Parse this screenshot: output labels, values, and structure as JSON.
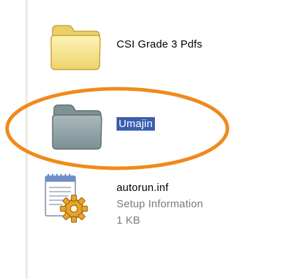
{
  "files": [
    {
      "name": "CSI Grade 3 Pdfs",
      "icon": "folder-icon"
    },
    {
      "name": "Umajin",
      "icon": "folder-icon",
      "selected": true
    },
    {
      "name": "autorun.inf",
      "type": "Setup Information",
      "size": "1 KB",
      "icon": "setup-information-icon"
    }
  ],
  "colors": {
    "selection_bg": "#3a5fb0",
    "annotation_circle": "#f08a1c",
    "folder_yellow": "#f6e58a",
    "folder_grey": "#8fa1a6"
  }
}
